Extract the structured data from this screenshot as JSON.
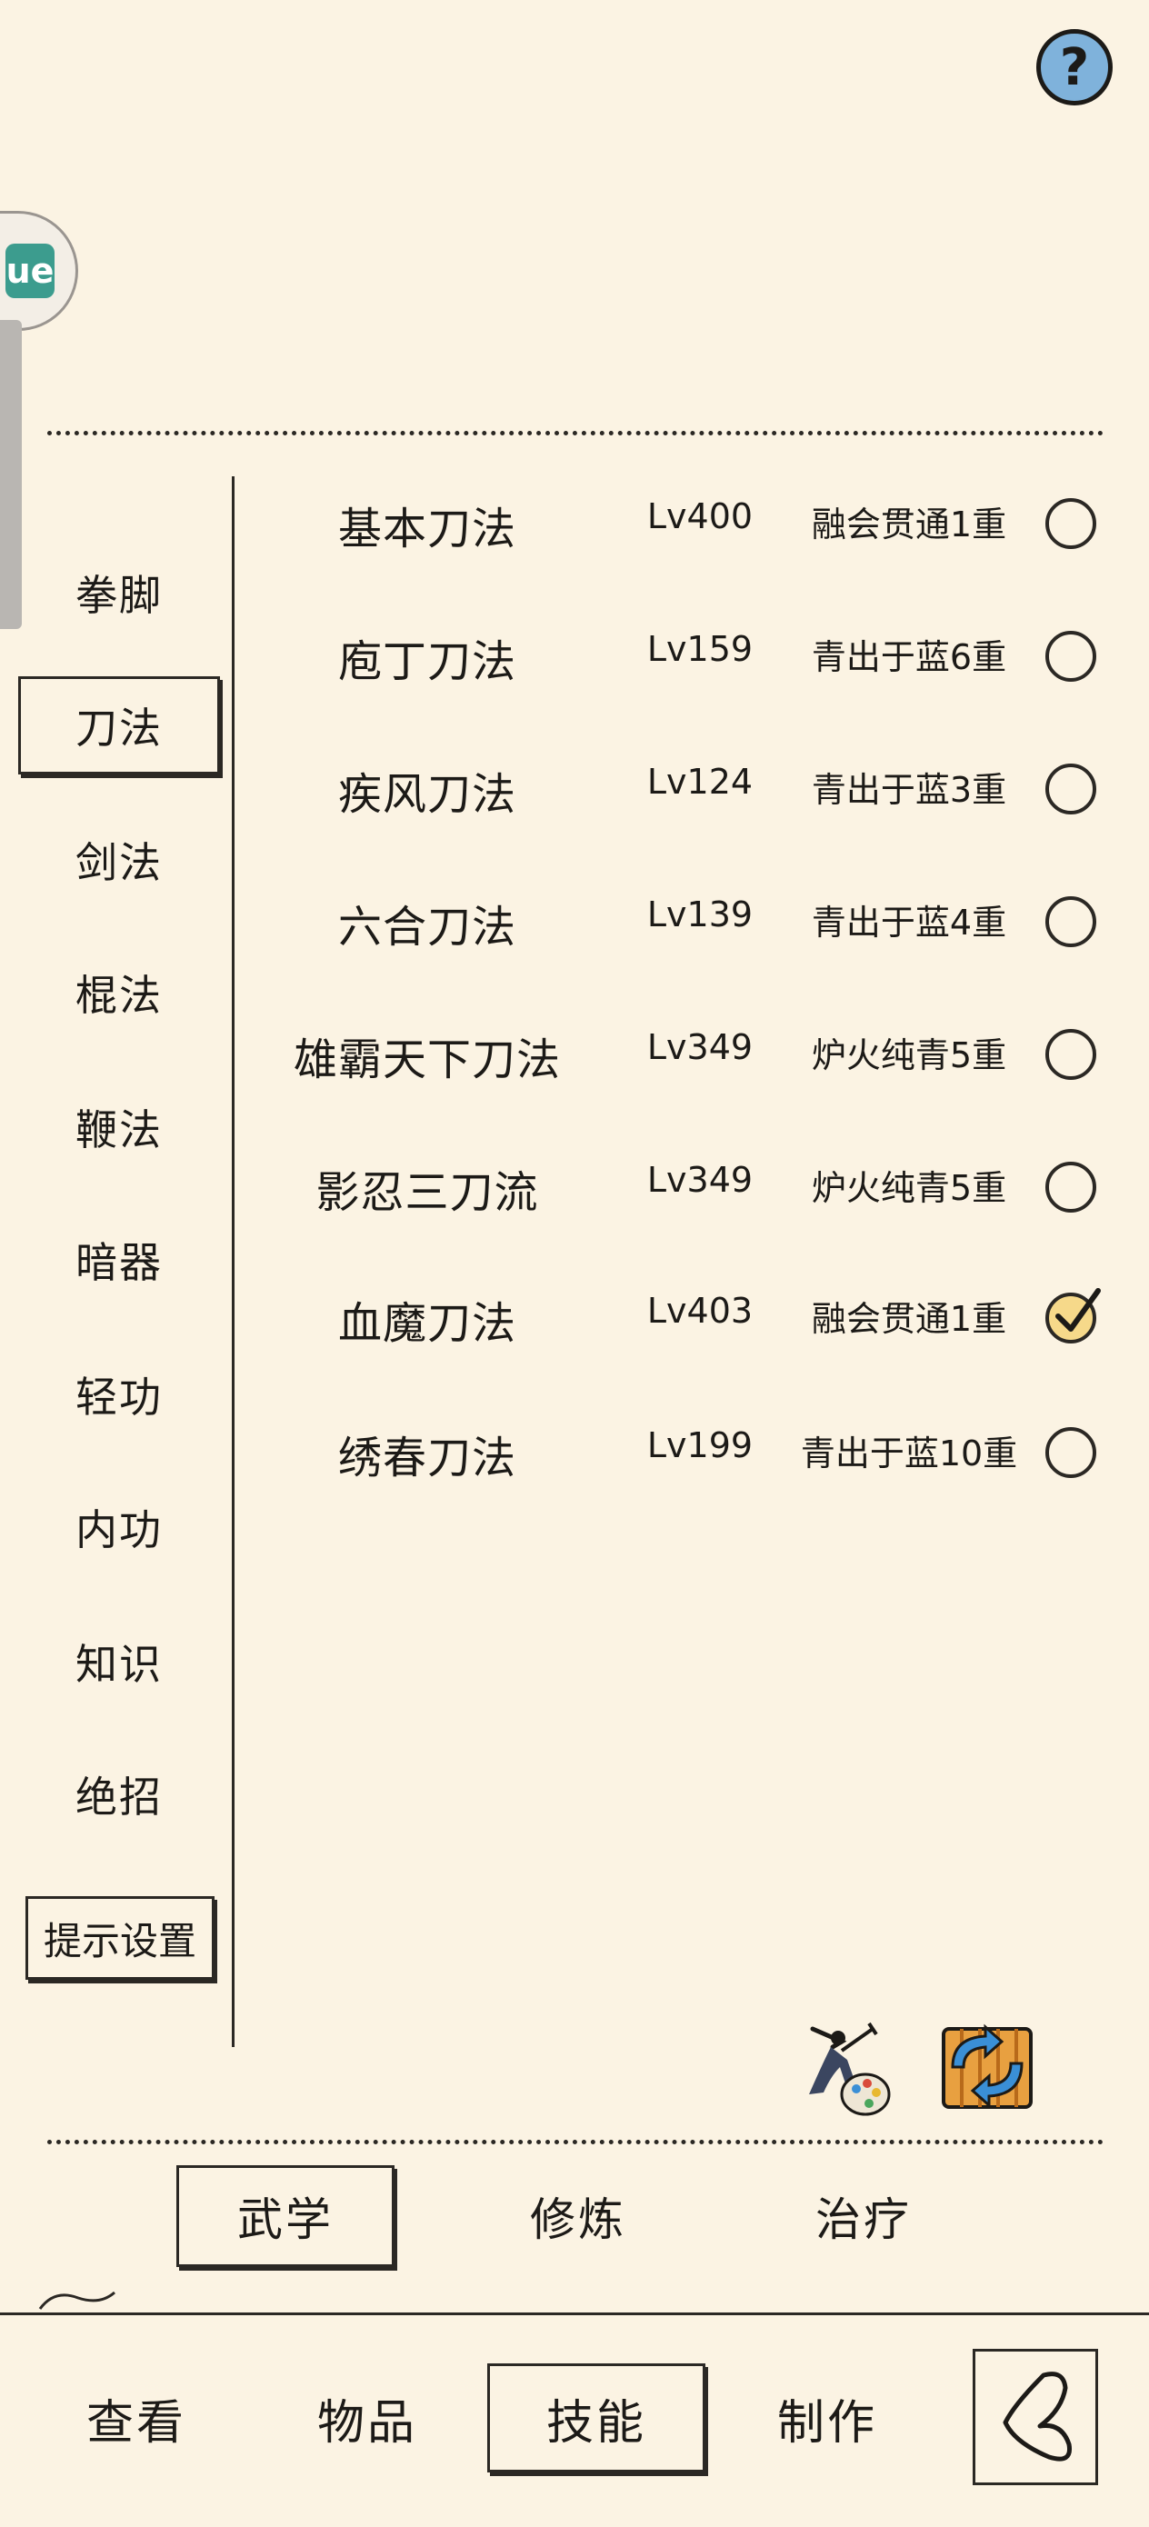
{
  "help": {
    "label": "?"
  },
  "float_logo": {
    "label": "ue"
  },
  "categories": [
    {
      "label": "拳脚",
      "active": false
    },
    {
      "label": "刀法",
      "active": true
    },
    {
      "label": "剑法",
      "active": false
    },
    {
      "label": "棍法",
      "active": false
    },
    {
      "label": "鞭法",
      "active": false
    },
    {
      "label": "暗器",
      "active": false
    },
    {
      "label": "轻功",
      "active": false
    },
    {
      "label": "内功",
      "active": false
    },
    {
      "label": "知识",
      "active": false
    },
    {
      "label": "绝招",
      "active": false
    }
  ],
  "hint_button": "提示设置",
  "skills": [
    {
      "name": "基本刀法",
      "level": "Lv400",
      "stage": "融会贯通1重",
      "selected": false
    },
    {
      "name": "庖丁刀法",
      "level": "Lv159",
      "stage": "青出于蓝6重",
      "selected": false
    },
    {
      "name": "疾风刀法",
      "level": "Lv124",
      "stage": "青出于蓝3重",
      "selected": false
    },
    {
      "name": "六合刀法",
      "level": "Lv139",
      "stage": "青出于蓝4重",
      "selected": false
    },
    {
      "name": "雄霸天下刀法",
      "level": "Lv349",
      "stage": "炉火纯青5重",
      "selected": false
    },
    {
      "name": "影忍三刀流",
      "level": "Lv349",
      "stage": "炉火纯青5重",
      "selected": false
    },
    {
      "name": "血魔刀法",
      "level": "Lv403",
      "stage": "融会贯通1重",
      "selected": true
    },
    {
      "name": "绣春刀法",
      "level": "Lv199",
      "stage": "青出于蓝10重",
      "selected": false
    }
  ],
  "sub_tabs": [
    {
      "label": "武学",
      "active": true
    },
    {
      "label": "修炼",
      "active": false
    },
    {
      "label": "治疗",
      "active": false
    }
  ],
  "main_tabs": [
    {
      "label": "查看",
      "active": false
    },
    {
      "label": "物品",
      "active": false
    },
    {
      "label": "技能",
      "active": true
    },
    {
      "label": "制作",
      "active": false
    }
  ],
  "colors": {
    "background": "#fbf3e3",
    "ink": "#2b2824",
    "help": "#7fb2db",
    "checked": "#f6d98a"
  }
}
